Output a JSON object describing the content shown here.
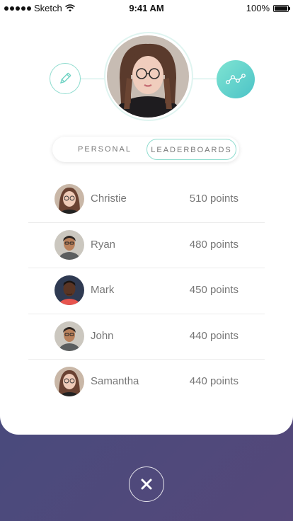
{
  "status_bar": {
    "carrier": "Sketch",
    "time": "9:41 AM",
    "battery": "100%"
  },
  "profile": {
    "edit_icon": "pencil-icon",
    "stats_icon": "line-graph-icon"
  },
  "tabs": [
    {
      "label": "PERSONAL",
      "active": false
    },
    {
      "label": "LEADERBOARDS",
      "active": true
    }
  ],
  "leaderboard": [
    {
      "name": "Christie",
      "points": "510 points"
    },
    {
      "name": "Ryan",
      "points": "480 points"
    },
    {
      "name": "Mark",
      "points": "450 points"
    },
    {
      "name": "John",
      "points": "440 points"
    },
    {
      "name": "Samantha",
      "points": "440 points"
    }
  ],
  "close_icon": "close-icon",
  "colors": {
    "accent": "#5fd0c6",
    "background_top": "#3d5a86",
    "background_bottom": "#55487a"
  }
}
